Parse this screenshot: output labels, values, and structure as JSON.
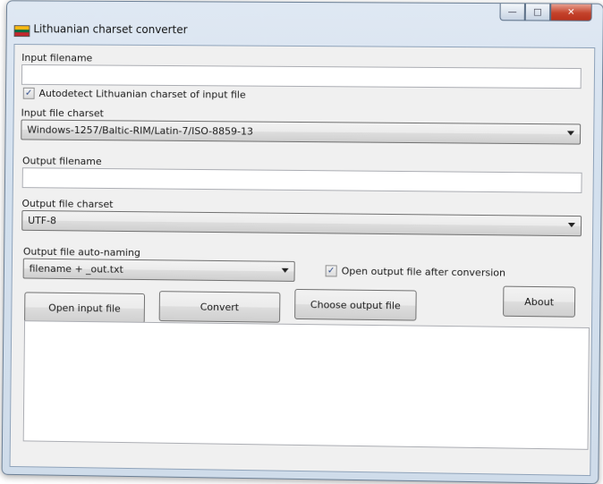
{
  "window": {
    "title": "Lithuanian charset converter",
    "icon": "lithuanian-flag-icon",
    "flag_colors": [
      "#fdb913",
      "#006a44",
      "#c1272d"
    ],
    "controls": {
      "minimize": "minimize-icon",
      "maximize": "maximize-icon",
      "close": "close-icon"
    }
  },
  "form": {
    "input_filename_label": "Input filename",
    "input_filename_value": "",
    "autodetect_label": "Autodetect Lithuanian charset of input file",
    "autodetect_checked": true,
    "input_charset_label": "Input file charset",
    "input_charset_value": "Windows-1257/Baltic-RIM/Latin-7/ISO-8859-13",
    "output_filename_label": "Output filename",
    "output_filename_value": "",
    "output_charset_label": "Output file charset",
    "output_charset_value": "UTF-8",
    "auto_naming_label": "Output file auto-naming",
    "auto_naming_value": "filename + _out.txt",
    "open_after_label": "Open output file after conversion",
    "open_after_checked": true
  },
  "buttons": {
    "open_input": "Open input file",
    "convert": "Convert",
    "choose_output": "Choose output file",
    "about": "About"
  },
  "log": {
    "text": ""
  }
}
